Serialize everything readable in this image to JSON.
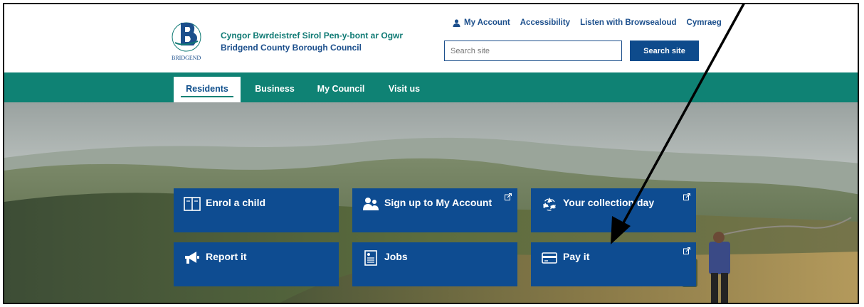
{
  "header": {
    "council_name_welsh": "Cyngor Bwrdeistref Sirol Pen-y-bont ar Ogwr",
    "council_name_english": "Bridgend County Borough Council",
    "logo_text": "BRIDGEND",
    "logo_small_text": "Pen-y-bont ar Ogwr"
  },
  "top_links": {
    "my_account": "My Account",
    "accessibility": "Accessibility",
    "browsealoud": "Listen with Browsealoud",
    "cymraeg": "Cymraeg"
  },
  "search": {
    "placeholder": "Search site",
    "button_label": "Search site"
  },
  "nav": {
    "tabs": [
      {
        "label": "Residents",
        "active": true
      },
      {
        "label": "Business",
        "active": false
      },
      {
        "label": "My Council",
        "active": false
      },
      {
        "label": "Visit us",
        "active": false
      }
    ]
  },
  "tiles": [
    {
      "label": "Enrol a child",
      "icon": "book-icon",
      "external": false
    },
    {
      "label": "Sign up to My Account",
      "icon": "users-icon",
      "external": true
    },
    {
      "label": "Your collection day",
      "icon": "recycle-icon",
      "external": true
    },
    {
      "label": "Report it",
      "icon": "megaphone-icon",
      "external": false
    },
    {
      "label": "Jobs",
      "icon": "document-icon",
      "external": false
    },
    {
      "label": "Pay it",
      "icon": "credit-card-icon",
      "external": true
    }
  ],
  "colors": {
    "nav_green": "#0f8274",
    "tile_blue": "#0e4c91",
    "link_blue": "#1c4f8c",
    "welsh_green": "#0f7a74"
  }
}
